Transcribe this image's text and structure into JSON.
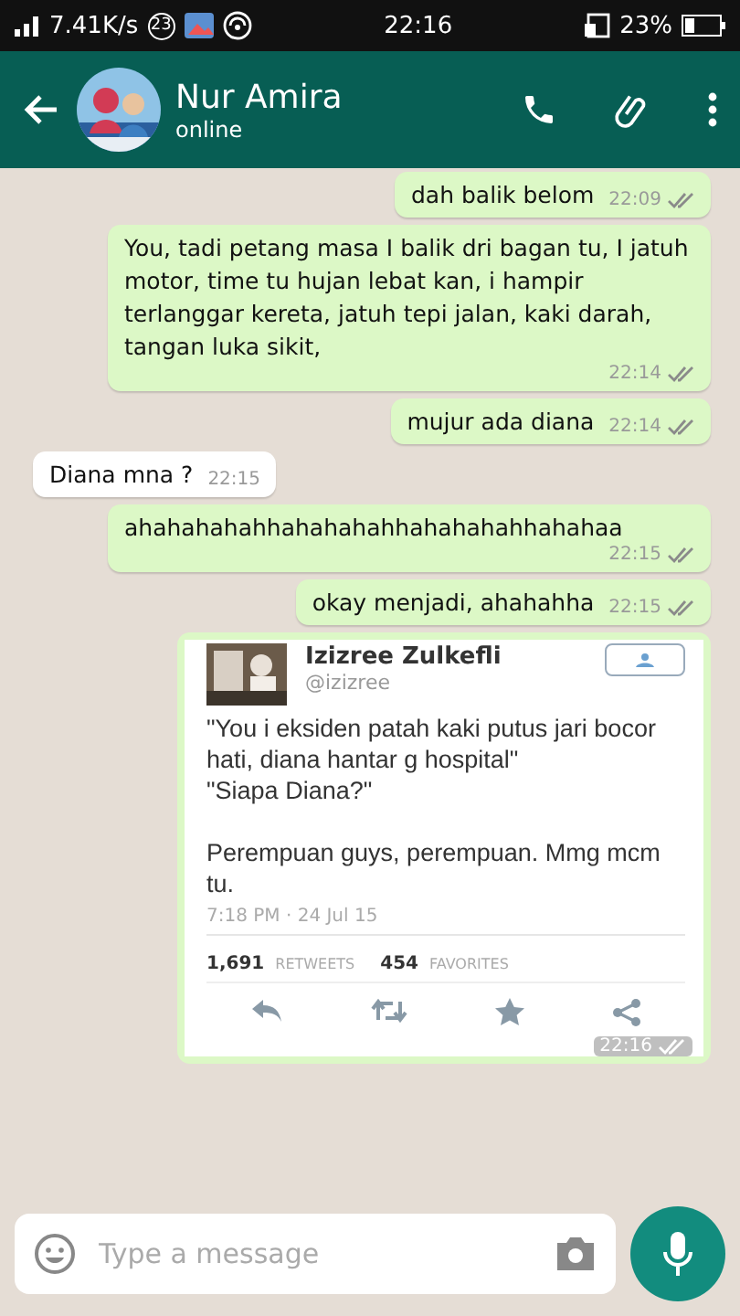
{
  "status_bar": {
    "speed": "7.41K/s",
    "badge": "23",
    "time": "22:16",
    "battery": "23%"
  },
  "header": {
    "name": "Nur Amira",
    "status": "online"
  },
  "messages": [
    {
      "kind": "out",
      "text": "dah balik belom",
      "time": "22:09"
    },
    {
      "kind": "out",
      "text": "You, tadi petang masa I balik dri bagan tu, I jatuh motor, time tu hujan lebat kan, i hampir terlanggar kereta, jatuh tepi jalan, kaki darah, tangan luka sikit,",
      "time": "22:14"
    },
    {
      "kind": "out",
      "text": "mujur ada diana",
      "time": "22:14"
    },
    {
      "kind": "in",
      "text": "Diana mna ?",
      "time": "22:15"
    },
    {
      "kind": "out",
      "text": "ahahahahahhahahahahhahahahahhahahaa",
      "time": "22:15"
    },
    {
      "kind": "out",
      "text": "okay menjadi, ahahahha",
      "time": "22:15"
    },
    {
      "kind": "tweet",
      "time": "22:16",
      "tweet": {
        "name": "Izizree Zulkefli",
        "handle": "@izizree",
        "text": "\"You i eksiden patah kaki putus jari bocor hati, diana hantar g hospital\"\n\"Siapa Diana?\"\n\nPerempuan guys, perempuan. Mmg mcm tu.",
        "date": "7:18 PM · 24 Jul 15",
        "retweets": "1,691",
        "retweets_label": "RETWEETS",
        "favorites": "454",
        "favorites_label": "FAVORITES"
      }
    }
  ],
  "composer": {
    "placeholder": "Type a message"
  }
}
